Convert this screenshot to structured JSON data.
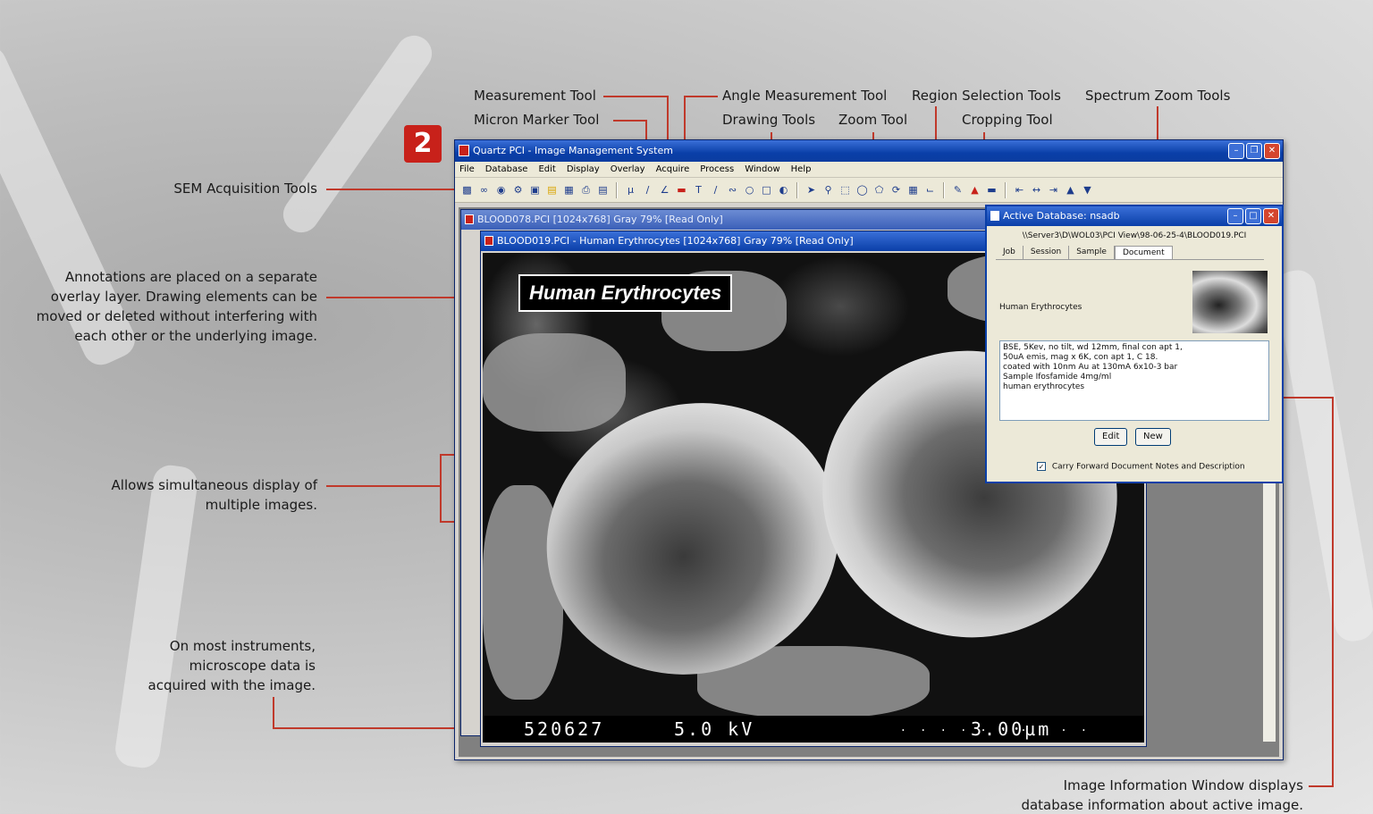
{
  "step_number": "2",
  "callouts": {
    "measurement_tool": "Measurement Tool",
    "micron_marker_tool": "Micron Marker Tool",
    "angle_measurement_tool": "Angle Measurement Tool",
    "drawing_tools": "Drawing Tools",
    "zoom_tool": "Zoom Tool",
    "region_selection_tools": "Region Selection Tools",
    "cropping_tool": "Cropping Tool",
    "spectrum_zoom_tools": "Spectrum Zoom Tools",
    "sem_acquisition_tools": "SEM Acquisition Tools",
    "annotations": [
      "Annotations are placed on a separate",
      "overlay layer. Drawing elements can be",
      "moved or deleted without interfering with",
      "each other or the underlying image."
    ],
    "multiple_images": [
      "Allows simultaneous display of",
      "multiple images."
    ],
    "microscope_data": [
      "On most instruments,",
      "microscope data is",
      "acquired with the image."
    ],
    "image_info_window": [
      "Image Information Window displays",
      "database information about active image."
    ]
  },
  "app": {
    "title": "Quartz PCI - Image Management System",
    "menu": [
      "File",
      "Database",
      "Edit",
      "Display",
      "Overlay",
      "Acquire",
      "Process",
      "Window",
      "Help"
    ]
  },
  "child_windows": {
    "back_title": "BLOOD078.PCI [1024x768] Gray 79% [Read Only]",
    "front_title": "BLOOD019.PCI - Human Erythrocytes [1024x768] Gray 79% [Read Only]",
    "annotation_text": "Human  Erythrocytes",
    "databar_id": "520627",
    "databar_kv": "5.0  kV",
    "databar_scale": "3.00µm",
    "scale_dots": ". . . . . . . . . ."
  },
  "active_db": {
    "title": "Active Database: nsadb",
    "path": "\\\\Server3\\D\\WOL03\\PCI View\\98-06-25-4\\BLOOD019.PCI",
    "tabs": [
      "Job",
      "Session",
      "Sample",
      "Document"
    ],
    "description": "Human Erythrocytes",
    "notes": [
      "BSE, 5Kev, no tilt, wd 12mm, final con apt 1,",
      "50uA emis, mag x 6K, con apt 1, C 18.",
      "",
      "coated with 10nm Au at 130mA 6x10-3 bar",
      "",
      "Sample Ifosfamide 4mg/ml",
      "human erythrocytes"
    ],
    "edit_label": "Edit",
    "new_label": "New",
    "carry_forward_label": "Carry Forward Document Notes and Description",
    "carry_forward_checked": "✓"
  },
  "colors": {
    "accent": "#c8211a",
    "leader": "#c0392b",
    "titlebar": "#0a3fa8"
  }
}
